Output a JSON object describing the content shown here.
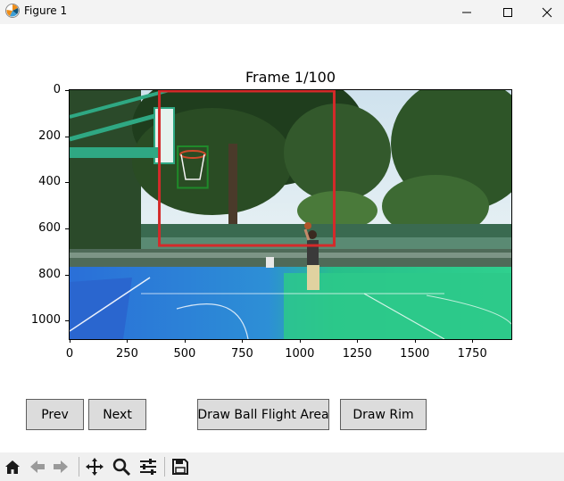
{
  "window": {
    "title": "Figure 1"
  },
  "figure": {
    "axes_title": "Frame 1/100",
    "image_alt": "Outdoor basketball court with a player shooting; red and green boxes mark regions",
    "y_ticks": [
      "0",
      "200",
      "400",
      "600",
      "800",
      "1000"
    ],
    "x_ticks": [
      "0",
      "250",
      "500",
      "750",
      "1000",
      "1250",
      "1500",
      "1750"
    ],
    "x_range": [
      0,
      1920
    ],
    "y_range": [
      0,
      1080
    ],
    "annotations": {
      "flight_area": {
        "label": "Ball Flight Area",
        "color": "#d42a2a",
        "x": [
          390,
          1150
        ],
        "y": [
          0,
          670
        ]
      },
      "rim": {
        "label": "Rim",
        "color": "#1f8a2a",
        "x": [
          470,
          600
        ],
        "y": [
          240,
          420
        ]
      }
    }
  },
  "buttons": {
    "prev": "Prev",
    "next": "Next",
    "draw_flight": "Draw Ball Flight Area",
    "draw_rim": "Draw Rim"
  },
  "toolbar": {
    "icons": [
      "home-icon",
      "back-arrow-icon",
      "forward-arrow-icon",
      "pan-icon",
      "zoom-icon",
      "configure-subplots-icon",
      "save-icon"
    ]
  }
}
